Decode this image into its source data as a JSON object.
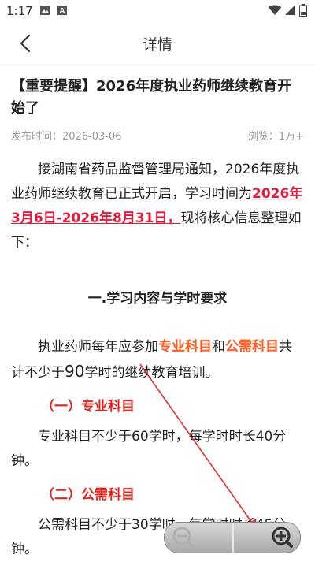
{
  "status_bar": {
    "time": "1:17",
    "icons": [
      "image-icon",
      "a-icon",
      "wifi-icon",
      "cell-signal-icon",
      "battery-icon"
    ]
  },
  "app_bar": {
    "back_icon": "chevron-left-icon",
    "title": "详情"
  },
  "article": {
    "title": "【重要提醒】2026年度执业药师继续教育开始了",
    "publish_time": "发布时间：2026-03-06",
    "views": "浏览：1万+",
    "intro": {
      "before": "接湖南省药品监督管理局通知，2026年度执业药师继续教育已正式开启，学习时间为",
      "highlight": "2026年3月6日-2026年8月31日，",
      "after": "现将核心信息整理如下："
    },
    "section1_heading": "一.学习内容与学时要求",
    "section1_para": {
      "p1": "执业药师每年应参加",
      "h1": "专业科目",
      "p2": "和",
      "h2": "公需科目",
      "p3": "共计不少于",
      "num": "90",
      "p4": "学时的继续教育培训。"
    },
    "sub1_heading": "（一）专业科目",
    "sub1_text": "专业科目不少于60学时，每学时时长40分钟。",
    "sub2_heading": "（二）公需科目",
    "sub2_text": "公需科目不少于30学时，每学时时长45分钟。"
  },
  "zoom_control": {
    "zoom_out_icon": "zoom-out-icon",
    "zoom_in_icon": "zoom-in-icon"
  },
  "colors": {
    "highlight_red": "#e01b3c",
    "highlight_orange": "#ff5a1f",
    "heading_red": "#e0261c",
    "meta_gray": "#999999"
  }
}
